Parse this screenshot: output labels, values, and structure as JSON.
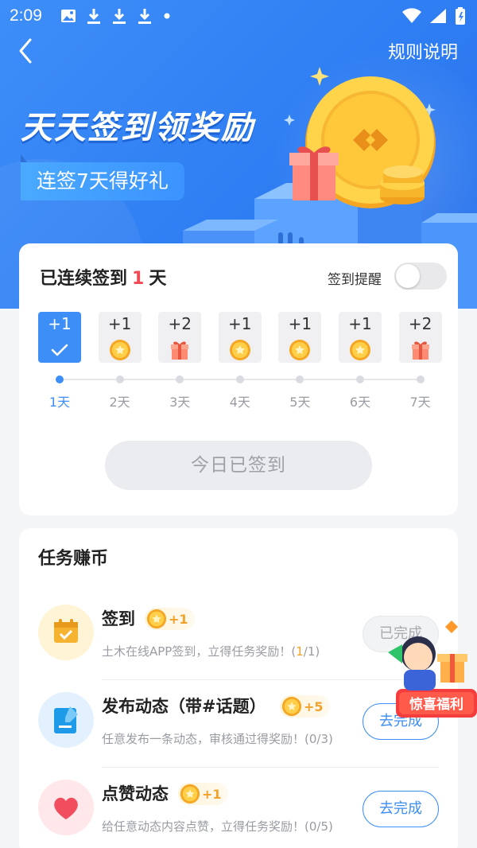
{
  "status_bar": {
    "time": "2:09",
    "icons": [
      "image-icon",
      "download-icon",
      "download-icon",
      "download-icon",
      "dot-icon"
    ],
    "right_icons": [
      "wifi-icon",
      "signal-icon",
      "battery-icon"
    ]
  },
  "header": {
    "rules_label": "规则说明"
  },
  "hero": {
    "title": "天天签到领奖励",
    "subtitle": "连签7天得好礼"
  },
  "checkin": {
    "title_prefix": "已连续签到",
    "streak_count": "1",
    "title_suffix": "天",
    "remind_label": "签到提醒",
    "remind_enabled": false,
    "days": [
      {
        "points": "+1",
        "label": "1天",
        "reward": "check",
        "active": true
      },
      {
        "points": "+1",
        "label": "2天",
        "reward": "coin",
        "active": false
      },
      {
        "points": "+2",
        "label": "3天",
        "reward": "gift",
        "active": false
      },
      {
        "points": "+1",
        "label": "4天",
        "reward": "coin",
        "active": false
      },
      {
        "points": "+1",
        "label": "5天",
        "reward": "coin",
        "active": false
      },
      {
        "points": "+1",
        "label": "6天",
        "reward": "coin",
        "active": false
      },
      {
        "points": "+2",
        "label": "7天",
        "reward": "gift",
        "active": false
      }
    ],
    "signed_button_label": "今日已签到"
  },
  "tasks": {
    "title": "任务赚币",
    "items": [
      {
        "name": "签到",
        "reward": "+1",
        "desc_prefix": "土木在线APP签到，立得任务奖励！(",
        "progress_done": "1",
        "desc_suffix": "/1)",
        "action_label": "已完成",
        "status": "done",
        "icon": "calendar-icon"
      },
      {
        "name": "发布动态（带#话题）",
        "reward": "+5",
        "desc_prefix": "任意发布一条动态，审核通过得奖励！(",
        "progress_done": "0",
        "desc_suffix": "/3)",
        "action_label": "去完成",
        "status": "todo",
        "icon": "edit-icon"
      },
      {
        "name": "点赞动态",
        "reward": "+1",
        "desc_prefix": "给任意动态内容点赞，立得任务奖励！(",
        "progress_done": "0",
        "desc_suffix": "/5)",
        "action_label": "去完成",
        "status": "todo",
        "icon": "heart-icon"
      }
    ]
  },
  "promo": {
    "label": "惊喜福利"
  },
  "colors": {
    "primary": "#3d8ef7",
    "accent_red": "#f04a55",
    "coin_orange": "#f2a12a"
  }
}
